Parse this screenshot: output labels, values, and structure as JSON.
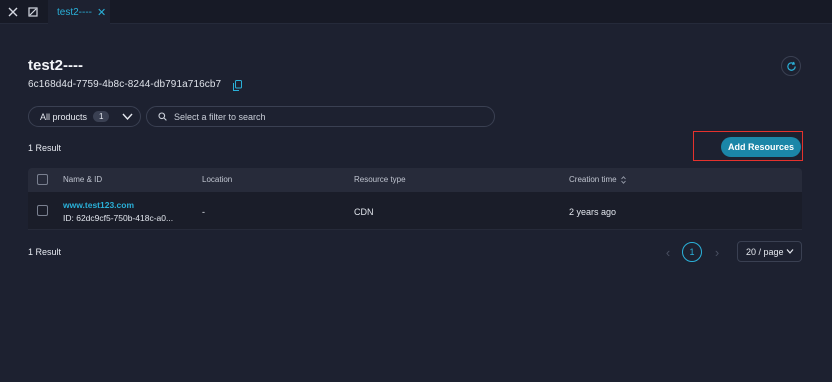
{
  "tab": {
    "label": "test2----"
  },
  "header": {
    "title": "test2----",
    "id": "6c168d4d-7759-4b8c-8244-db791a716cb7"
  },
  "filters": {
    "product_label": "All products",
    "product_count": "1",
    "search_placeholder": "Select a filter to search"
  },
  "results": {
    "top_count": "1 Result",
    "bottom_count": "1 Result"
  },
  "actions": {
    "add_resources": "Add Resources"
  },
  "table": {
    "columns": [
      "Name & ID",
      "Location",
      "Resource type",
      "Creation time"
    ],
    "rows": [
      {
        "name": "www.test123.com",
        "id": "ID: 62dc9cf5-750b-418c-a0...",
        "location": "-",
        "resource_type": "CDN",
        "creation_time": "2 years ago"
      }
    ]
  },
  "pagination": {
    "prev": "‹",
    "current_page": "1",
    "next": "›",
    "page_size": "20 / page"
  },
  "colors": {
    "accent": "#2ab0d8",
    "button": "#1b86a8",
    "highlight": "#e5322d",
    "background": "#1d2130"
  }
}
